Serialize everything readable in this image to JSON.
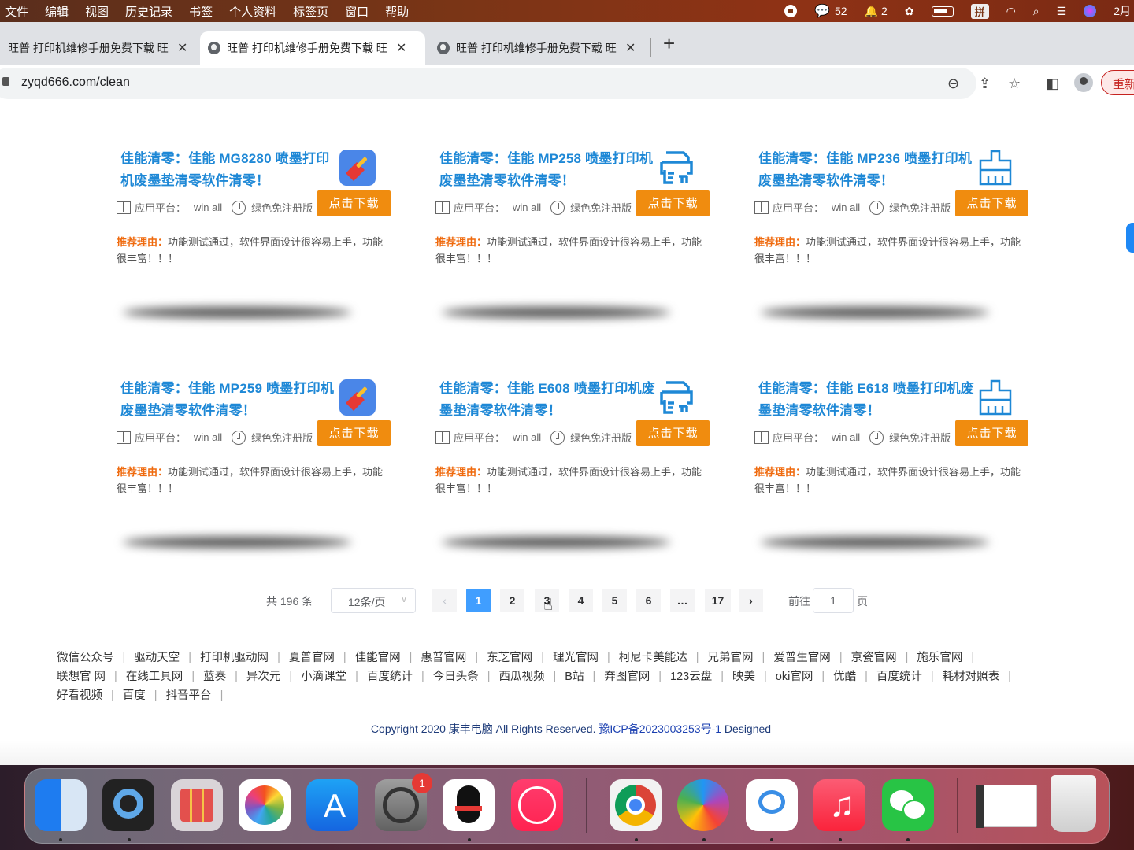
{
  "menubar": {
    "items": [
      "文件",
      "编辑",
      "视图",
      "历史记录",
      "书签",
      "个人资料",
      "标签页",
      "窗口",
      "帮助"
    ],
    "status": {
      "wechat_count": "52",
      "qq_count": "2",
      "input_method": "拼",
      "clock": "2月"
    }
  },
  "tabs": [
    {
      "title": "旺普 打印机维修手册免费下载 旺",
      "active": false
    },
    {
      "title": "旺普 打印机维修手册免费下载 旺",
      "active": true
    },
    {
      "title": "旺普 打印机维修手册免费下载 旺",
      "active": false
    }
  ],
  "address": {
    "url": "zyqd666.com/clean",
    "reload_label": "重新"
  },
  "cards": [
    {
      "title": "佳能清零：佳能 MG8280 喷墨打印机废墨垫清零软件清零！",
      "icon": "broom-app-icon"
    },
    {
      "title": "佳能清零：佳能 MP258 喷墨打印机废墨垫清零软件清零！",
      "icon": "printer-icon"
    },
    {
      "title": "佳能清零：佳能 MP236 喷墨打印机废墨垫清零软件清零！",
      "icon": "brush-outline-icon"
    },
    {
      "title": "佳能清零：佳能 MP259 喷墨打印机废墨垫清零软件清零！",
      "icon": "broom-app-icon"
    },
    {
      "title": "佳能清零：佳能 E608 喷墨打印机废墨垫清零软件清零！",
      "icon": "printer-icon"
    },
    {
      "title": "佳能清零：佳能 E618 喷墨打印机废墨垫清零软件清零！",
      "icon": "brush-outline-icon"
    }
  ],
  "card_common": {
    "platform_label": "应用平台：",
    "platform_value": "win all",
    "license": "绿色免注册版",
    "download_label": "点击下载",
    "reason_label": "推荐理由：",
    "reason_text": "功能测试通过，软件界面设计很容易上手，功能很丰富！！！"
  },
  "pagination": {
    "total": "共 196 条",
    "page_size": "12条/页",
    "prev": "‹",
    "pages": [
      "1",
      "2",
      "3",
      "4",
      "5",
      "6",
      "…",
      "17"
    ],
    "current": "1",
    "next": "›",
    "goto_label": "前往",
    "goto_value": "1",
    "goto_suffix": "页"
  },
  "footer": {
    "links": [
      "微信公众号",
      "驱动天空",
      "打印机驱动网",
      "夏普官网",
      "佳能官网",
      "惠普官网",
      "东芝官网",
      "理光官网",
      "柯尼卡美能达",
      "兄弟官网",
      "爱普生官网",
      "京瓷官网",
      "施乐官网",
      "联想官 网",
      "在线工具网",
      "蓝奏",
      "异次元",
      "小滴课堂",
      "百度统计",
      "今日头条",
      "西瓜视频",
      "B站",
      "奔图官网",
      "123云盘",
      "映美",
      "oki官网",
      "优酷",
      "百度统计",
      "耗材对照表",
      "好看视频",
      "百度",
      "抖音平台"
    ],
    "copyright": "Copyright 2020 康丰电脑 All Rights Reserved. ",
    "icp": "豫ICP备2023003253号-1",
    "designed": " Designed"
  },
  "dock": {
    "apps": [
      "finder",
      "quicktime",
      "launchpad",
      "photos",
      "app-store",
      "system-preferences",
      "qq",
      "meitu",
      "chrome",
      "browser-360",
      "baidu-netdisk",
      "music",
      "wechat",
      "screenshot-preview",
      "trash"
    ],
    "settings_badge": "1"
  }
}
